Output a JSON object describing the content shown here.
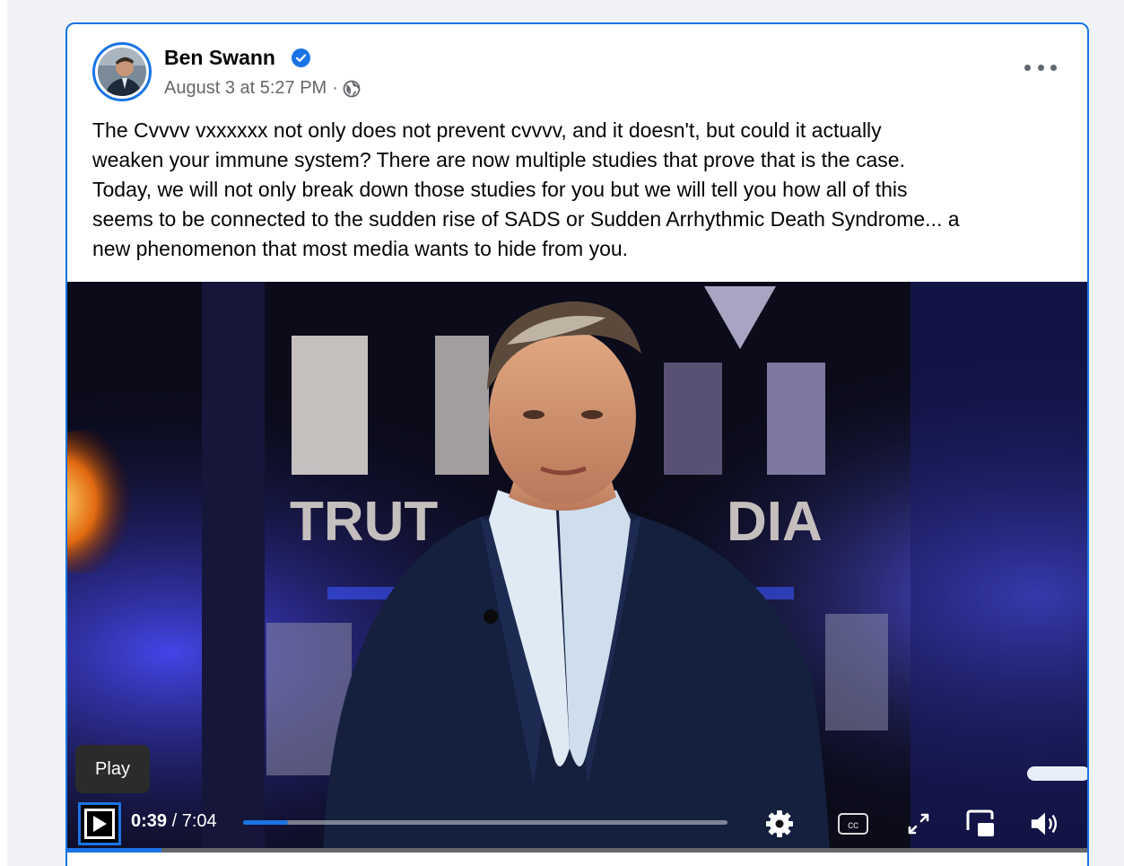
{
  "post": {
    "author": "Ben Swann",
    "timestamp": "August 3 at 5:27 PM",
    "separator": "·",
    "audience_icon": "globe-icon",
    "verified_icon": "verified-badge-icon",
    "text_lines": [
      "The Cvvvv vxxxxxx not only does not prevent cvvvv, and it doesn't, but could it actually",
      "weaken your immune system?  There are now multiple studies that prove that is the case.",
      "Today, we will not only break down those studies for you but we will tell you how all of this",
      "seems to be connected to the sudden rise of SADS or Sudden Arrhythmic Death Syndrome... a",
      "new phenomenon that most media wants to hide from you."
    ]
  },
  "video": {
    "tooltip": "Play",
    "current_time": "0:39",
    "time_separator": " / ",
    "duration": "7:04",
    "progress_fraction": 0.092,
    "backdrop": {
      "logo_line_1": "TRUT",
      "logo_line_2": "DIA"
    },
    "controls": [
      "play-icon",
      "settings-gear-icon",
      "closed-captions-icon",
      "fullscreen-icon",
      "picture-in-picture-icon",
      "volume-icon"
    ]
  },
  "colors": {
    "accent": "#1b74e4",
    "text_primary": "#050505",
    "text_secondary": "#65676b",
    "page_bg": "#f0f2f5"
  }
}
